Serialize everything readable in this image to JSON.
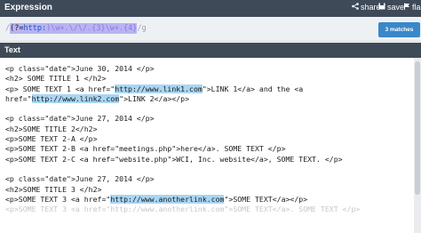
{
  "header": {
    "title": "Expression",
    "share_label": "share",
    "save_label": "save",
    "flag_label": "fla"
  },
  "expression": {
    "open_slash": "/",
    "pattern_prefix": "(?=",
    "pattern_body": "http:",
    "pattern_rest": ")\\w+.\\/\\/.{3}\\w+.{4}",
    "close_slash": "/",
    "flags": "g"
  },
  "matches_label": "3 matches",
  "text_section": {
    "title": "Text"
  },
  "lines": [
    {
      "segs": [
        {
          "t": "<p class=\"date\">June 30, 2014 </p>"
        }
      ]
    },
    {
      "segs": [
        {
          "t": "<h2> SOME TITLE 1 </h2>"
        }
      ]
    },
    {
      "segs": [
        {
          "t": "<p> SOME TEXT 1 <a href=\""
        },
        {
          "t": "http://www.link1.com",
          "hl": true
        },
        {
          "t": "\">LINK 1</a> and the <a"
        }
      ]
    },
    {
      "segs": [
        {
          "t": "href=\""
        },
        {
          "t": "http://www.link2.com",
          "hl": true
        },
        {
          "t": "\">LINK 2</a></p>"
        }
      ]
    },
    {
      "segs": [
        {
          "t": ""
        }
      ]
    },
    {
      "segs": [
        {
          "t": "<p class=\"date\">June 27, 2014 </p>"
        }
      ]
    },
    {
      "segs": [
        {
          "t": "<h2>SOME TITLE 2</h2>"
        }
      ]
    },
    {
      "segs": [
        {
          "t": "<p>SOME TEXT 2-A </p>"
        }
      ]
    },
    {
      "segs": [
        {
          "t": "<p>SOME TEXT 2-B <a href=\"meetings.php\">here</a>. SOME TEXT </p>"
        }
      ]
    },
    {
      "segs": [
        {
          "t": "<p>SOME TEXT 2-C <a href=\"website.php\">WCI, Inc. website</a>, SOME TEXT. </p>"
        }
      ]
    },
    {
      "segs": [
        {
          "t": ""
        }
      ]
    },
    {
      "segs": [
        {
          "t": "<p class=\"date\">June 27, 2014 </p>"
        }
      ]
    },
    {
      "segs": [
        {
          "t": "<h2>SOME TITLE 3 </h2>"
        }
      ]
    },
    {
      "segs": [
        {
          "t": "<p>SOME TEXT 3 <a href=\""
        },
        {
          "t": "http://www.anotherlink.com",
          "hl": true
        },
        {
          "t": "\">SOME TEXT</a></p>"
        }
      ]
    },
    {
      "segs": [
        {
          "t": "<p>SOME TEXT 3 <a href=\"http://www.anotherlink.com\">SOME TEXT</a>. SOME TEXT </p>"
        }
      ],
      "faded": true
    }
  ]
}
